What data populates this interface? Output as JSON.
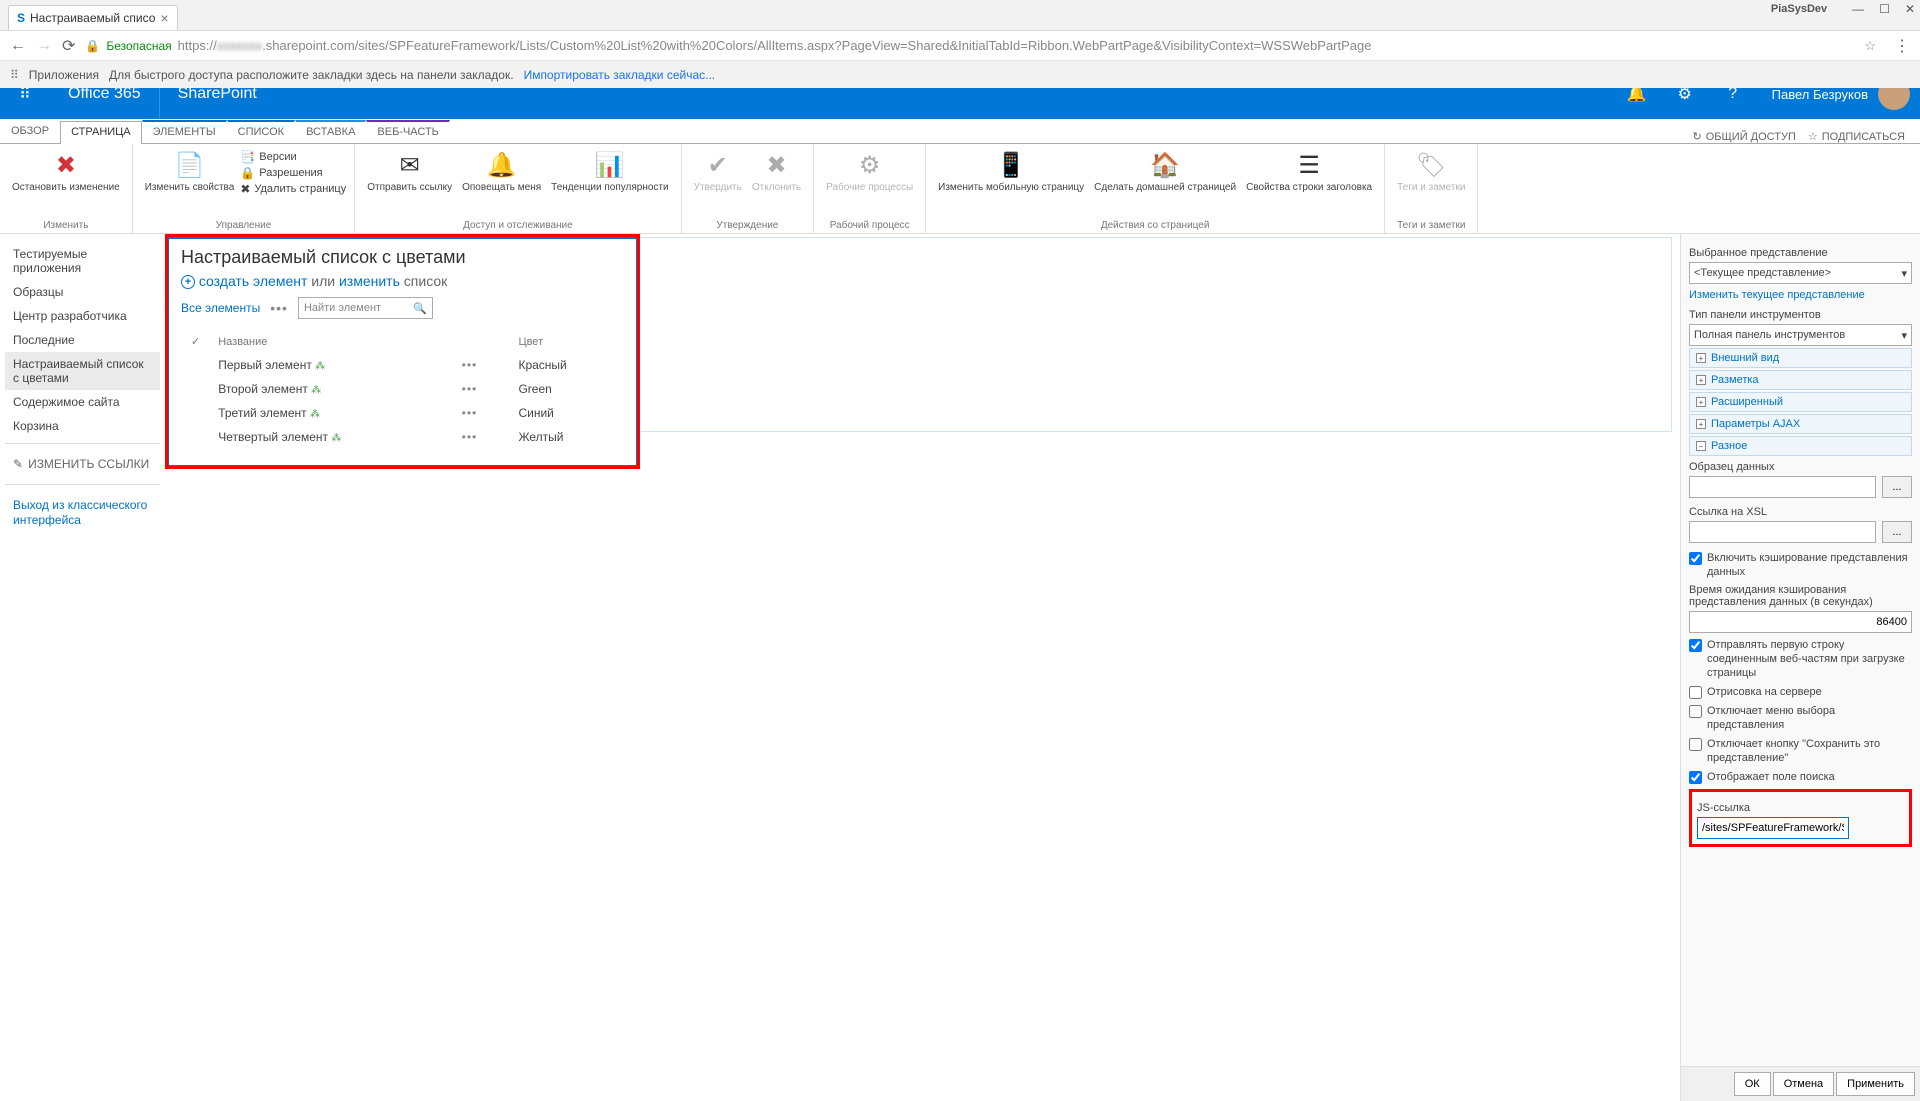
{
  "browser": {
    "tab_title": "Настраиваемый списо",
    "user_label": "PiaSysDev",
    "secure_label": "Безопасная",
    "url_prefix": "https://",
    "url_host": ".sharepoint.com",
    "url_path": "/sites/SPFeatureFramework/Lists/Custom%20List%20with%20Colors/AllItems.aspx?PageView=Shared&InitialTabId=Ribbon.WebPartPage&VisibilityContext=WSSWebPartPage",
    "apps_label": "Приложения",
    "bookmark_hint": "Для быстрого доступа расположите закладки здесь на панели закладок.",
    "import_link": "Импортировать закладки сейчас..."
  },
  "suite": {
    "brand": "Office 365",
    "app": "SharePoint",
    "user": "Павел Безруков"
  },
  "ribbon_tabs": {
    "overview": "ОБЗОР",
    "page": "СТРАНИЦА",
    "elements": "ЭЛЕМЕНТЫ",
    "list": "СПИСОК",
    "insert": "ВСТАВКА",
    "webpart": "ВЕБ-ЧАСТЬ",
    "share": "ОБЩИЙ ДОСТУП",
    "follow": "ПОДПИСАТЬСЯ"
  },
  "ribbon": {
    "g1_label": "Изменить",
    "stop_edit": "Остановить изменение",
    "g2_label": "Управление",
    "edit_props": "Изменить свойства",
    "versions": "Версии",
    "permissions": "Разрешения",
    "delete_page": "Удалить страницу",
    "g3_label": "Доступ и отслеживание",
    "send_link": "Отправить ссылку",
    "notify": "Оповещать меня",
    "trends": "Тенденции популярности",
    "g4_label": "Утверждение",
    "approve": "Утвердить",
    "reject": "Отклонить",
    "g5_label": "Рабочий процесс",
    "workflows": "Рабочие процессы",
    "g6_label": "Действия со страницей",
    "edit_mobile": "Изменить мобильную страницу",
    "make_home": "Сделать домашней страницей",
    "title_props": "Свойства строки заголовка",
    "g7_label": "Теги и заметки",
    "tags": "Теги и заметки"
  },
  "leftnav": {
    "test_apps": "Тестируемые приложения",
    "samples": "Образцы",
    "dev_center": "Центр разработчика",
    "recent": "Последние",
    "custom_list": "Настраиваемый список с цветами",
    "site_contents": "Содержимое сайта",
    "recycle": "Корзина",
    "edit_links": "ИЗМЕНИТЬ ССЫЛКИ",
    "exit": "Выход из классического интерфейса"
  },
  "webpart": {
    "title": "Настраиваемый список с цветами",
    "create": "создать элемент",
    "or": "или",
    "edit": "изменить",
    "list_word": "список",
    "all_items": "Все элементы",
    "search_ph": "Найти элемент",
    "col_title": "Название",
    "col_color": "Цвет",
    "rows": [
      {
        "title": "Первый элемент",
        "color": "Красный"
      },
      {
        "title": "Второй элемент",
        "color": "Green"
      },
      {
        "title": "Третий элемент",
        "color": "Синий"
      },
      {
        "title": "Четвертый элемент",
        "color": "Желтый"
      }
    ]
  },
  "panel": {
    "selected_view_label": "Выбранное представление",
    "current_view": "<Текущее представление>",
    "edit_view_link": "Изменить текущее представление",
    "toolbar_type_label": "Тип панели инструментов",
    "toolbar_full": "Полная панель инструментов",
    "sec_appearance": "Внешний вид",
    "sec_layout": "Разметка",
    "sec_advanced": "Расширенный",
    "sec_ajax": "Параметры AJAX",
    "sec_misc": "Разное",
    "sample_data": "Образец данных",
    "xsl_link": "Ссылка на XSL",
    "enable_cache": "Включить кэширование представления данных",
    "cache_timeout_label": "Время ожидания кэширования представления данных (в секундах)",
    "cache_timeout_value": "86400",
    "send_first_row": "Отправлять первую строку соединенным веб-частям при загрузке страницы",
    "server_render": "Отрисовка на сервере",
    "disable_view_menu": "Отключает меню выбора представления",
    "disable_save_view": "Отключает кнопку \"Сохранить это представление\"",
    "show_search": "Отображает поле поиска",
    "js_link_label": "JS-ссылка",
    "js_link_value": "/sites/SPFeatureFramework/Sit",
    "browse_btn": "...",
    "ok": "ОК",
    "cancel": "Отмена",
    "apply": "Применить"
  }
}
